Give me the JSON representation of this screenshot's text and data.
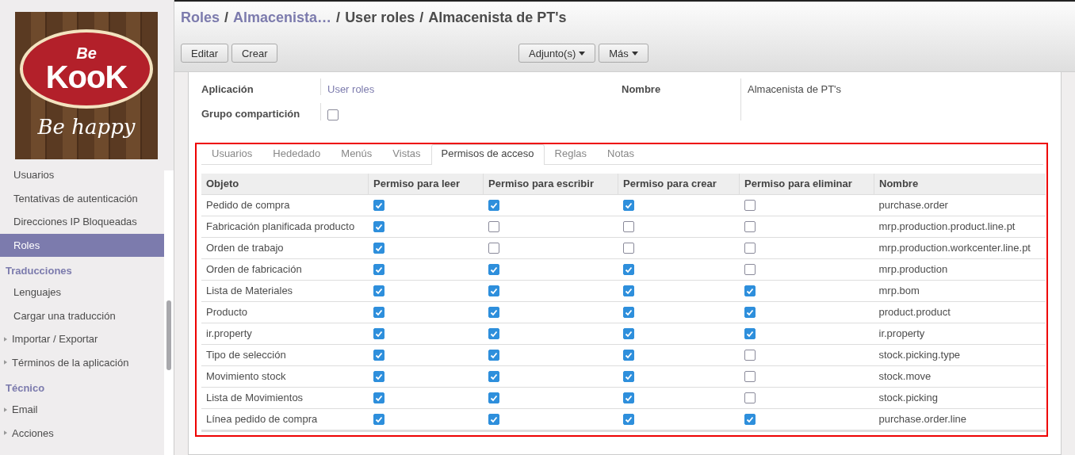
{
  "sidebar": {
    "logo": {
      "top": "Be",
      "main": "KooK",
      "tagline": "Be happy"
    },
    "items": [
      {
        "label": "Usuarios",
        "kind": "item",
        "selected": false
      },
      {
        "label": "Tentativas de autenticación",
        "kind": "item",
        "selected": false
      },
      {
        "label": "Direcciones IP Bloqueadas",
        "kind": "item",
        "selected": false
      },
      {
        "label": "Roles",
        "kind": "item",
        "selected": true
      },
      {
        "label": "Traducciones",
        "kind": "section"
      },
      {
        "label": "Lenguajes",
        "kind": "item",
        "selected": false
      },
      {
        "label": "Cargar una traducción",
        "kind": "item",
        "selected": false
      },
      {
        "label": "Importar / Exportar",
        "kind": "expander",
        "selected": false
      },
      {
        "label": "Términos de la aplicación",
        "kind": "expander",
        "selected": false
      },
      {
        "label": "Técnico",
        "kind": "section"
      },
      {
        "label": "Email",
        "kind": "expander",
        "selected": false
      },
      {
        "label": "Acciones",
        "kind": "expander",
        "selected": false
      }
    ]
  },
  "breadcrumb_separator": "/",
  "breadcrumb": [
    {
      "label": "Roles",
      "kind": "link"
    },
    {
      "label": "Almacenista…",
      "kind": "link"
    },
    {
      "label": "User roles",
      "kind": "current"
    },
    {
      "label": "Almacenista de PT's",
      "kind": "current"
    }
  ],
  "buttons": [
    "Editar",
    "Crear"
  ],
  "dropdowns": [
    "Adjunto(s)",
    "Más"
  ],
  "form": {
    "application_label": "Aplicación",
    "application_value": "User roles",
    "share_label": "Grupo compartición",
    "share_checked": false,
    "name_label": "Nombre",
    "name_value": "Almacenista de PT's"
  },
  "tabs": [
    {
      "label": "Usuarios",
      "selected": false
    },
    {
      "label": "Hededado",
      "selected": false
    },
    {
      "label": "Menús",
      "selected": false
    },
    {
      "label": "Vistas",
      "selected": false
    },
    {
      "label": "Permisos de acceso",
      "selected": true
    },
    {
      "label": "Reglas",
      "selected": false
    },
    {
      "label": "Notas",
      "selected": false
    }
  ],
  "table": {
    "columns": [
      "Objeto",
      "Permiso para leer",
      "Permiso para escribir",
      "Permiso para crear",
      "Permiso para eliminar",
      "Nombre"
    ],
    "rows": [
      {
        "object": "Pedido de compra",
        "read": true,
        "write": true,
        "create": true,
        "delete": false,
        "name": "purchase.order"
      },
      {
        "object": "Fabricación planificada producto",
        "read": true,
        "write": false,
        "create": false,
        "delete": false,
        "name": "mrp.production.product.line.pt"
      },
      {
        "object": "Orden de trabajo",
        "read": true,
        "write": false,
        "create": false,
        "delete": false,
        "name": "mrp.production.workcenter.line.pt"
      },
      {
        "object": "Orden de fabricación",
        "read": true,
        "write": true,
        "create": true,
        "delete": false,
        "name": "mrp.production"
      },
      {
        "object": "Lista de Materiales",
        "read": true,
        "write": true,
        "create": true,
        "delete": true,
        "name": "mrp.bom"
      },
      {
        "object": "Producto",
        "read": true,
        "write": true,
        "create": true,
        "delete": true,
        "name": "product.product"
      },
      {
        "object": "ir.property",
        "read": true,
        "write": true,
        "create": true,
        "delete": true,
        "name": "ir.property"
      },
      {
        "object": "Tipo de selección",
        "read": true,
        "write": true,
        "create": true,
        "delete": false,
        "name": "stock.picking.type"
      },
      {
        "object": "Movimiento stock",
        "read": true,
        "write": true,
        "create": true,
        "delete": false,
        "name": "stock.move"
      },
      {
        "object": "Lista de Movimientos",
        "read": true,
        "write": true,
        "create": true,
        "delete": false,
        "name": "stock.picking"
      },
      {
        "object": "Línea pedido de compra",
        "read": true,
        "write": true,
        "create": true,
        "delete": true,
        "name": "purchase.order.line"
      }
    ]
  }
}
